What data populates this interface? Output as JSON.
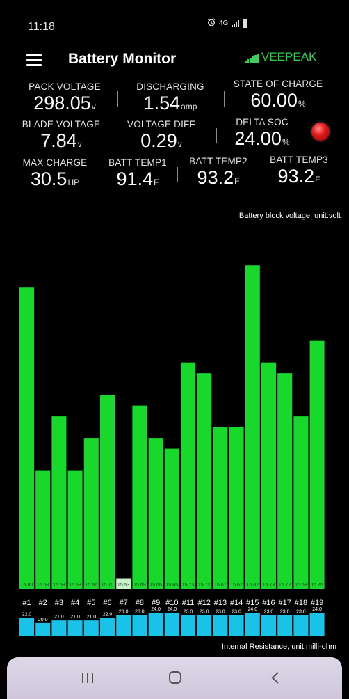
{
  "status_bar": {
    "time": "11:18",
    "network": "4G",
    "icons": [
      "alarm-icon",
      "signal-icon",
      "battery-icon"
    ]
  },
  "app_bar": {
    "title": "Battery Monitor",
    "brand": "VEEPEAK"
  },
  "metrics": {
    "pack_voltage": {
      "label": "PACK VOLTAGE",
      "value": "298.05",
      "unit": "v"
    },
    "discharging": {
      "label": "DISCHARGING",
      "value": "1.54",
      "unit": "amp"
    },
    "state_of_charge": {
      "label": "STATE OF CHARGE",
      "value": "60.00",
      "unit": "%"
    },
    "blade_voltage": {
      "label": "BLADE VOLTAGE",
      "value": "7.84",
      "unit": "v"
    },
    "voltage_diff": {
      "label": "VOLTAGE DIFF",
      "value": "0.29",
      "unit": "v"
    },
    "delta_soc": {
      "label": "DELTA SOC",
      "value": "24.00",
      "unit": "%"
    },
    "max_charge": {
      "label": "MAX CHARGE",
      "value": "30.5",
      "unit": "HP"
    },
    "batt_temp1": {
      "label": "BATT TEMP1",
      "value": "91.4",
      "unit": "F"
    },
    "batt_temp2": {
      "label": "BATT TEMP2",
      "value": "93.2",
      "unit": "F"
    },
    "batt_temp3": {
      "label": "BATT TEMP3",
      "value": "93.2",
      "unit": "F"
    }
  },
  "chart_data": [
    {
      "type": "bar",
      "title": "Battery block voltage, unit:volt",
      "categories": [
        "#1",
        "#2",
        "#3",
        "#4",
        "#5",
        "#6",
        "#7",
        "#8",
        "#9",
        "#10",
        "#11",
        "#12",
        "#13",
        "#14",
        "#15",
        "#16",
        "#17",
        "#18",
        "#19"
      ],
      "values": [
        15.8,
        15.63,
        15.68,
        15.63,
        15.66,
        15.7,
        15.53,
        15.69,
        15.66,
        15.65,
        15.73,
        15.72,
        15.67,
        15.67,
        15.82,
        15.73,
        15.72,
        15.68,
        15.75
      ],
      "data_labels": [
        "15.80",
        "15.63",
        "15.68",
        "15.63",
        "15.66",
        "15.70",
        "15.53",
        "15.69",
        "15.66",
        "15.65",
        "15.73",
        "15.72",
        "15.67",
        "15.67",
        "15.82",
        "15.73",
        "15.72",
        "15.68",
        "15.75"
      ],
      "ylim": [
        15.52,
        15.835
      ],
      "colors": {
        "bar": "#19d82c",
        "min_bar": "#c8f2c8"
      },
      "grid": false
    },
    {
      "type": "bar",
      "title": "Internal Resistance, unit:milli-ohm",
      "categories": [
        "#1",
        "#2",
        "#3",
        "#4",
        "#5",
        "#6",
        "#7",
        "#8",
        "#9",
        "#10",
        "#11",
        "#12",
        "#13",
        "#14",
        "#15",
        "#16",
        "#17",
        "#18",
        "#19"
      ],
      "values": [
        22.0,
        20.0,
        21.0,
        21.0,
        21.0,
        22.0,
        23.0,
        23.0,
        24.0,
        24.0,
        23.0,
        23.0,
        23.0,
        23.0,
        24.0,
        23.0,
        23.0,
        23.0,
        24.0
      ],
      "data_labels": [
        "22.0",
        "20.0",
        "21.0",
        "21.0",
        "21.0",
        "22.0",
        "23.0",
        "23.0",
        "24.0",
        "24.0",
        "23.0",
        "23.0",
        "23.0",
        "23.0",
        "24.0",
        "23.0",
        "23.0",
        "23.0",
        "24.0"
      ],
      "ylim": [
        17,
        24
      ],
      "colors": {
        "bar": "#19c2e8"
      },
      "grid": false
    }
  ],
  "nav_bar": {
    "buttons": [
      "recent-apps",
      "home",
      "back"
    ]
  }
}
